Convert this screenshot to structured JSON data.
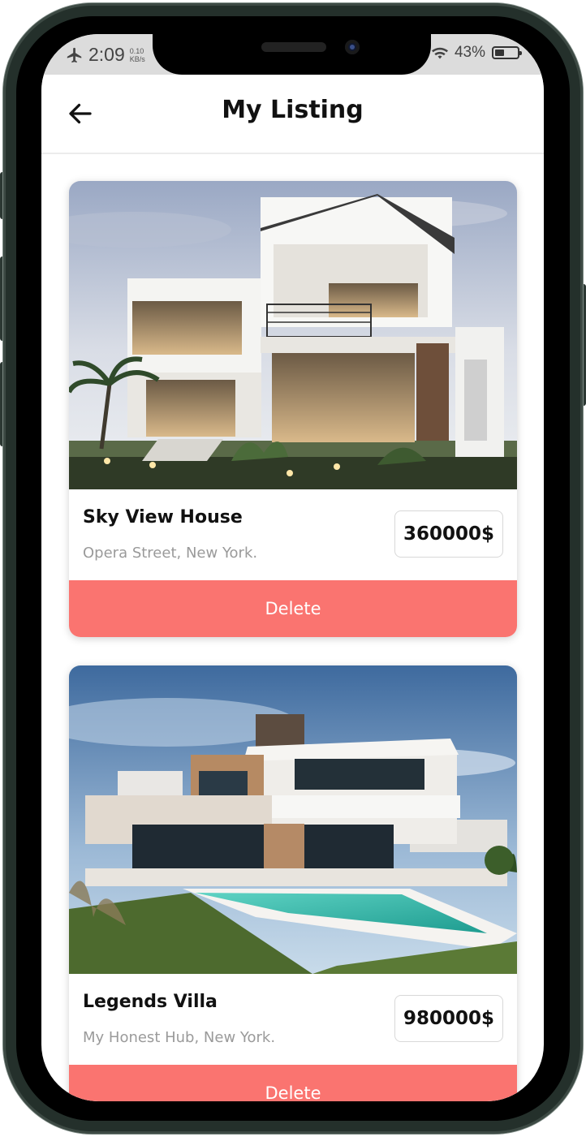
{
  "status_bar": {
    "time": "2:09",
    "speed_value": "0.10",
    "speed_unit": "KB/s",
    "battery": "43%",
    "battery_level": 0.43
  },
  "header": {
    "title": "My Listing",
    "back_icon": "arrow-left-icon"
  },
  "listings": [
    {
      "name": "Sky View House",
      "address": "Opera Street, New York.",
      "price": "360000$",
      "delete_label": "Delete"
    },
    {
      "name": "Legends Villa",
      "address": "My Honest Hub, New York.",
      "price": "980000$",
      "delete_label": "Delete"
    }
  ],
  "colors": {
    "accent": "#fa7470",
    "frame": "#24302b"
  }
}
